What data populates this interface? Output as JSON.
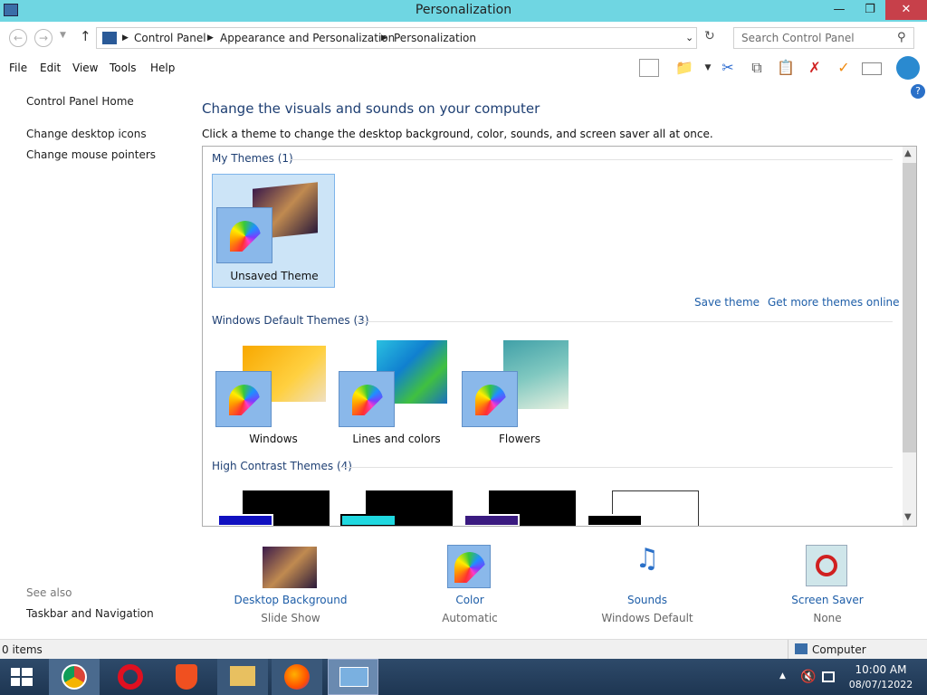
{
  "window": {
    "title": "Personalization"
  },
  "address": {
    "crumbs": [
      "Control Panel",
      "Appearance and Personalization",
      "Personalization"
    ],
    "search_placeholder": "Search Control Panel"
  },
  "menu": [
    "File",
    "Edit",
    "View",
    "Tools",
    "Help"
  ],
  "sidebar": {
    "home": "Control Panel Home",
    "links": [
      "Change desktop icons",
      "Change mouse pointers"
    ],
    "see_also_label": "See also",
    "see_also": [
      "Taskbar and Navigation"
    ]
  },
  "main": {
    "heading": "Change the visuals and sounds on your computer",
    "description": "Click a theme to change the desktop background, color, sounds, and screen saver all at once.",
    "my_themes": {
      "title": "My Themes (1)",
      "items": [
        "Unsaved Theme"
      ]
    },
    "save_theme": "Save theme",
    "get_more": "Get more themes online",
    "default_themes": {
      "title": "Windows Default Themes (3)",
      "items": [
        "Windows",
        "Lines and colors",
        "Flowers"
      ]
    },
    "high_contrast": {
      "title": "High Contrast Themes (4)"
    }
  },
  "bottom": [
    {
      "title": "Desktop Background",
      "sub": "Slide Show"
    },
    {
      "title": "Color",
      "sub": "Automatic"
    },
    {
      "title": "Sounds",
      "sub": "Windows Default"
    },
    {
      "title": "Screen Saver",
      "sub": "None"
    }
  ],
  "status": {
    "items": "0 items",
    "location": "Computer"
  },
  "taskbar": {
    "time": "10:00 AM",
    "date": "08/07/12022"
  },
  "colors": {
    "titlebar": "#6fd6e2",
    "close": "#c7404a",
    "link": "#1e5ea8",
    "heading": "#1e3f73"
  }
}
